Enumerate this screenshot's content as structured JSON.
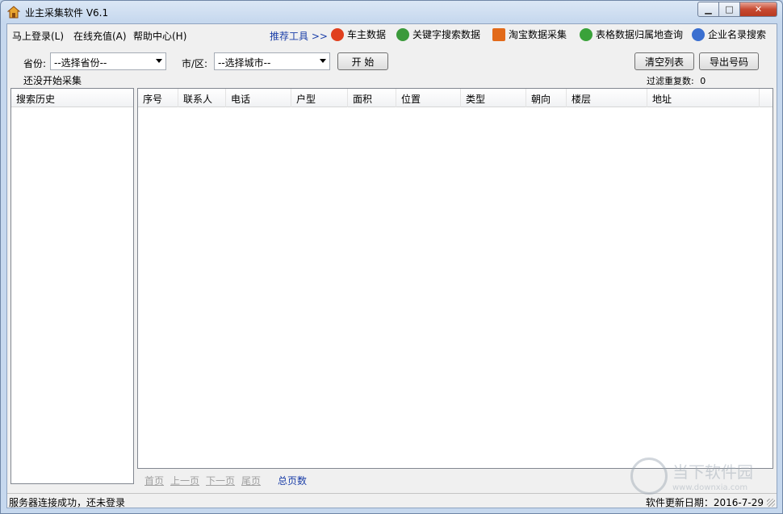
{
  "window": {
    "title": "业主采集软件 V6.1"
  },
  "menu": {
    "login": "马上登录(L)",
    "recharge": "在线充值(A)",
    "help": "帮助中心(H)"
  },
  "recommend": "推荐工具 >>",
  "tools": [
    {
      "label": "车主数据",
      "icon": "car-data-icon",
      "color": "#e0401e"
    },
    {
      "label": "关键字搜索数据",
      "icon": "keyword-search-icon",
      "color": "#3b9a3b"
    },
    {
      "label": "淘宝数据采集",
      "icon": "taobao-bag-icon",
      "color": "#e26a1a"
    },
    {
      "label": "表格数据归属地查询",
      "icon": "table-location-icon",
      "color": "#3aa23a"
    },
    {
      "label": "企业名录搜索",
      "icon": "company-search-icon",
      "color": "#3a6fd0"
    }
  ],
  "filter": {
    "province_label": "省份:",
    "province_value": "--选择省份--",
    "city_label": "市/区:",
    "city_value": "--选择城市--",
    "start_button": "开 始",
    "clear_button": "清空列表",
    "export_button": "导出号码",
    "status": "还没开始采集",
    "dup_label": "过滤重复数:",
    "dup_value": "0"
  },
  "history": {
    "title": "搜索历史"
  },
  "table": {
    "columns": [
      "序号",
      "联系人",
      "电话",
      "户型",
      "面积",
      "位置",
      "类型",
      "朝向",
      "楼层",
      "地址"
    ]
  },
  "pager": {
    "first": "首页",
    "prev": "上一页",
    "next": "下一页",
    "last": "尾页",
    "total": "总页数"
  },
  "statusbar": {
    "left": "服务器连接成功，还未登录",
    "right": "软件更新日期：2016-7-29"
  },
  "watermark": {
    "text": "当下软件园",
    "url": "www.downxia.com"
  }
}
